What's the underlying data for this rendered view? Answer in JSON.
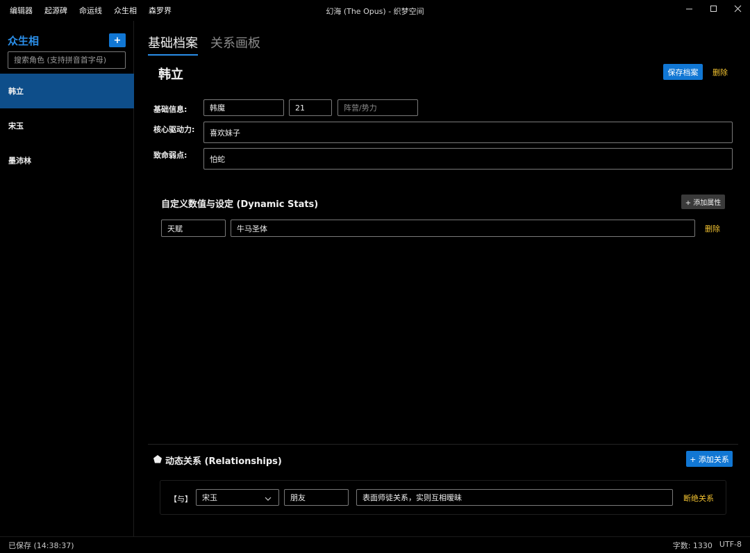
{
  "menu": [
    "编辑器",
    "起源碑",
    "命运线",
    "众生相",
    "森罗界"
  ],
  "window": {
    "title": "幻海 (The Opus) - 织梦空间"
  },
  "sidebar": {
    "title": "众生相",
    "add_label": "+",
    "search_placeholder": "搜索角色 (支持拼音首字母)",
    "characters": [
      {
        "name": "韩立",
        "active": true
      },
      {
        "name": "宋玉",
        "active": false
      },
      {
        "name": "墨沛林",
        "active": false
      }
    ]
  },
  "tabs": [
    {
      "label": "基础档案",
      "active": true
    },
    {
      "label": "关系画板",
      "active": false
    }
  ],
  "profile": {
    "name": "韩立",
    "save_label": "保存档案",
    "delete_label": "删除",
    "basic_label": "基础信息:",
    "basic_name": "韩魔",
    "basic_age": "21",
    "faction_placeholder": "阵营/势力",
    "drive_label": "核心驱动力:",
    "drive_value": "喜欢妹子",
    "weakness_label": "致命弱点:",
    "weakness_value": "怕蛇"
  },
  "stats": {
    "title": "自定义数值与设定 (Dynamic Stats)",
    "add_label": "+ 添加属性",
    "rows": [
      {
        "key": "天赋",
        "value": "牛马圣体",
        "delete_label": "删除"
      }
    ]
  },
  "relationships": {
    "title": "动态关系 (Relationships)",
    "add_label": "+ 添加关系",
    "rows": [
      {
        "prefix": "【与】",
        "target": "宋玉",
        "type": "朋友",
        "desc": "表面师徒关系，实则互相暧昧",
        "break_label": "断绝关系"
      }
    ]
  },
  "status": {
    "saved": "已保存 (14:38:37)",
    "word_count": "字数: 1330",
    "encoding": "UTF-8"
  },
  "colors": {
    "accent": "#1177d4",
    "warning": "#f2c230",
    "active_item": "#0e4e8a"
  }
}
